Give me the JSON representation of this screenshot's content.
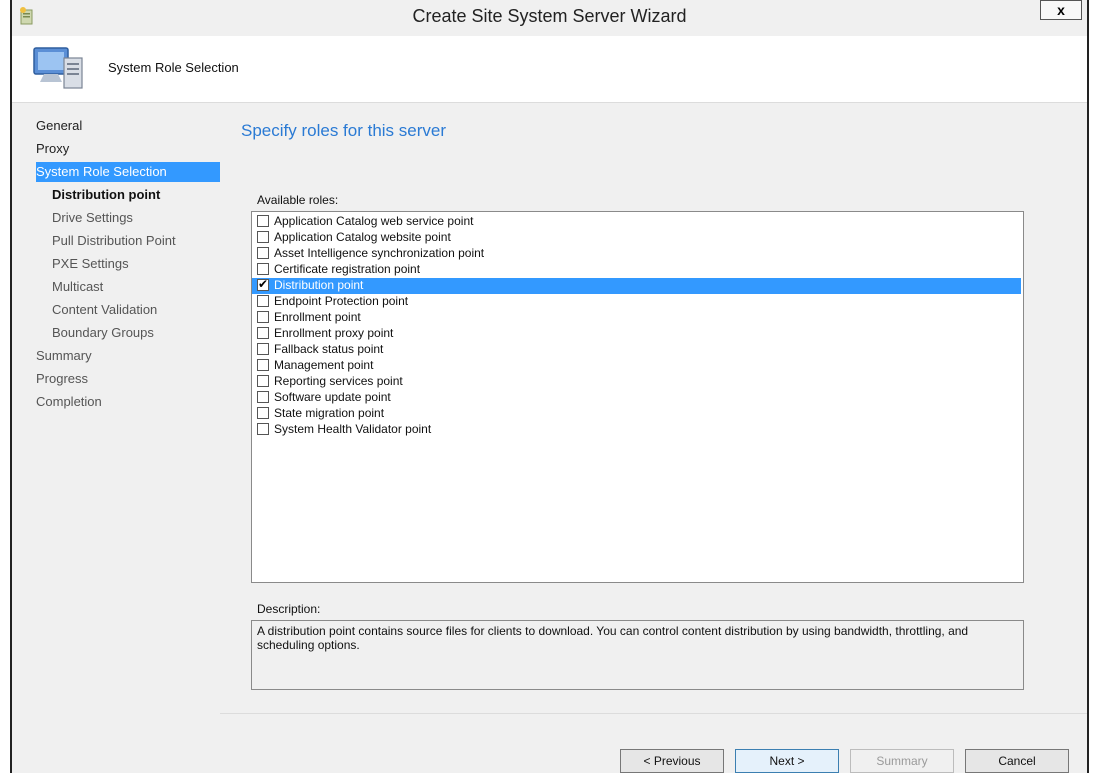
{
  "window": {
    "title": "Create Site System Server Wizard",
    "close_label": "x"
  },
  "header": {
    "title": "System Role Selection"
  },
  "nav": {
    "items": [
      {
        "label": "General"
      },
      {
        "label": "Proxy"
      },
      {
        "label": "System Role Selection"
      },
      {
        "label": "Distribution point"
      },
      {
        "label": "Drive Settings"
      },
      {
        "label": "Pull Distribution Point"
      },
      {
        "label": "PXE Settings"
      },
      {
        "label": "Multicast"
      },
      {
        "label": "Content Validation"
      },
      {
        "label": "Boundary Groups"
      },
      {
        "label": "Summary"
      },
      {
        "label": "Progress"
      },
      {
        "label": "Completion"
      }
    ]
  },
  "main": {
    "heading": "Specify roles for this server",
    "roles_label": "Available roles:",
    "roles": [
      {
        "label": "Application Catalog web service point",
        "checked": false
      },
      {
        "label": "Application Catalog website point",
        "checked": false
      },
      {
        "label": "Asset Intelligence synchronization point",
        "checked": false
      },
      {
        "label": "Certificate registration point",
        "checked": false
      },
      {
        "label": "Distribution point",
        "checked": true
      },
      {
        "label": "Endpoint Protection point",
        "checked": false
      },
      {
        "label": "Enrollment point",
        "checked": false
      },
      {
        "label": "Enrollment proxy point",
        "checked": false
      },
      {
        "label": "Fallback status point",
        "checked": false
      },
      {
        "label": "Management point",
        "checked": false
      },
      {
        "label": "Reporting services point",
        "checked": false
      },
      {
        "label": "Software update point",
        "checked": false
      },
      {
        "label": "State migration point",
        "checked": false
      },
      {
        "label": "System Health Validator point",
        "checked": false
      }
    ],
    "description_label": "Description:",
    "description": "A distribution point contains source files for clients to download. You can control content distribution by using bandwidth, throttling, and scheduling options."
  },
  "buttons": {
    "previous": "< Previous",
    "next": "Next >",
    "summary": "Summary",
    "cancel": "Cancel"
  },
  "colors": {
    "selection": "#3399ff",
    "heading": "#2a7ad4"
  }
}
